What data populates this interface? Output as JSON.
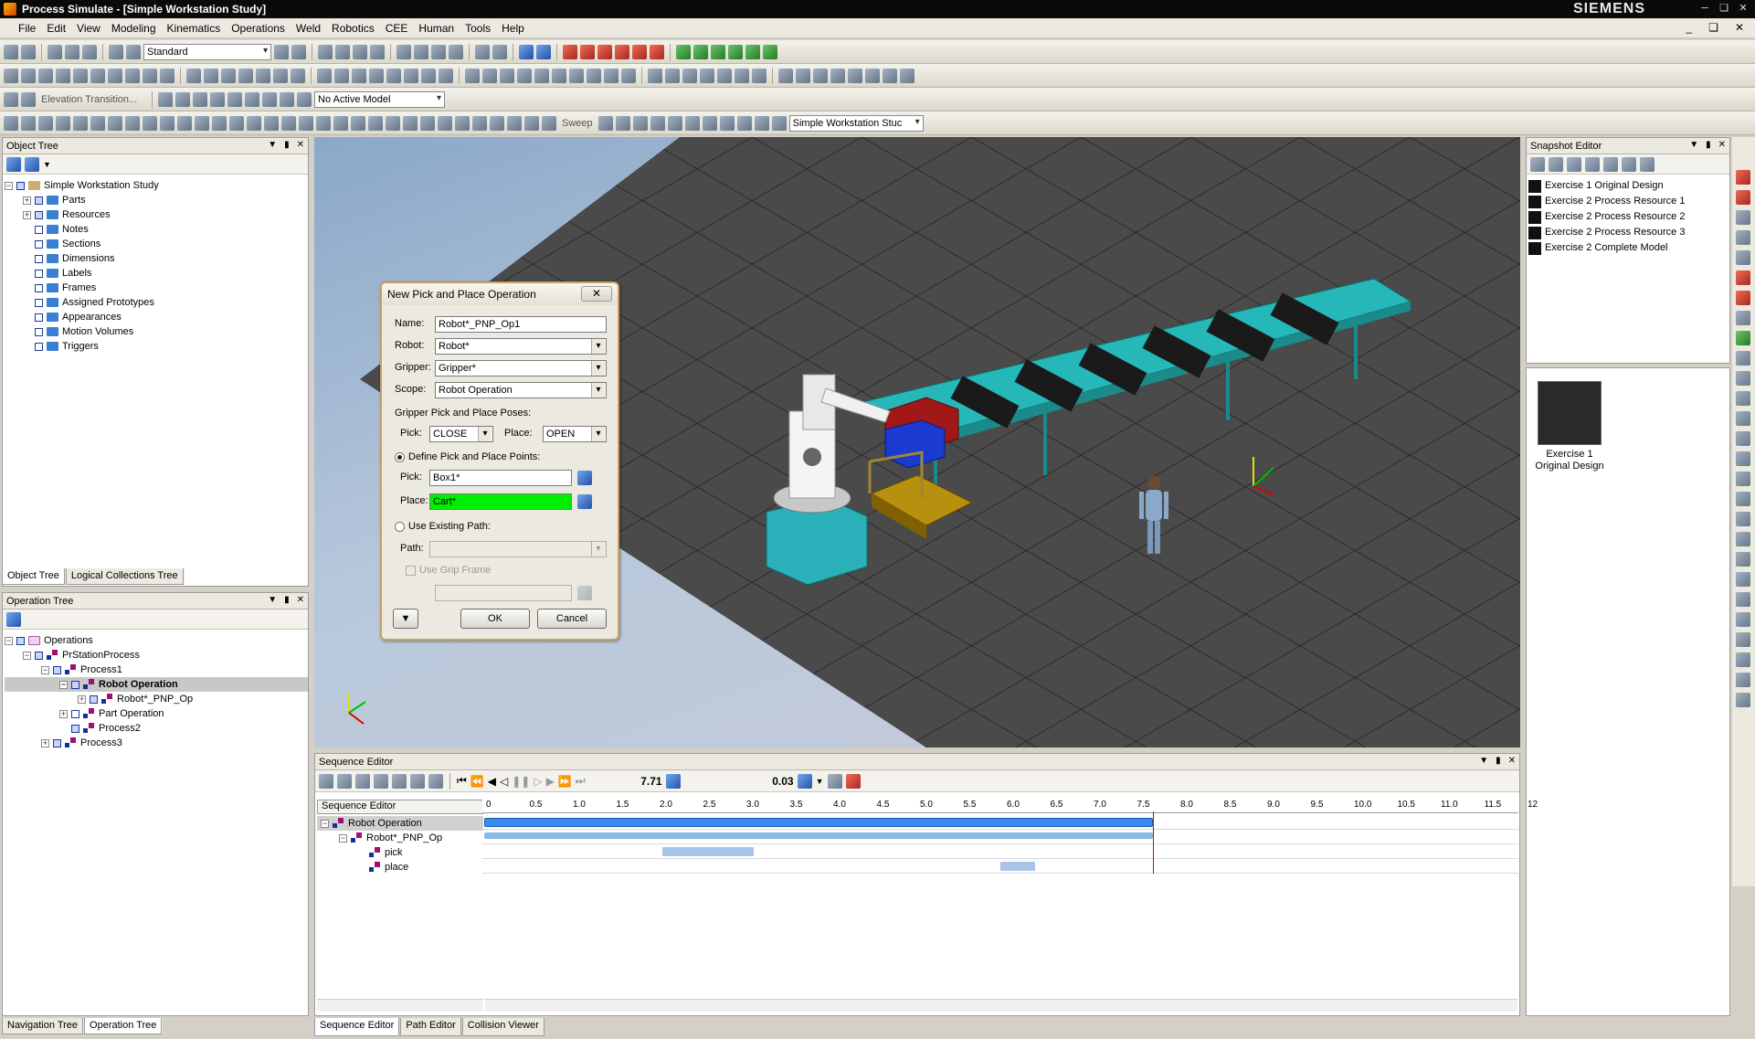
{
  "window": {
    "title": "Process Simulate - [Simple Workstation Study]",
    "brand": "SIEMENS"
  },
  "menu": [
    "File",
    "Edit",
    "View",
    "Modeling",
    "Kinematics",
    "Operations",
    "Weld",
    "Robotics",
    "CEE",
    "Human",
    "Tools",
    "Help"
  ],
  "toolbar": {
    "layout_combo": "Standard",
    "elevation": "Elevation Transition...",
    "model_combo": "No Active Model",
    "sweep": "Sweep",
    "study_combo": "Simple Workstation Stuc"
  },
  "object_tree": {
    "title": "Object Tree",
    "root": "Simple Workstation Study",
    "items": [
      "Parts",
      "Resources",
      "Notes",
      "Sections",
      "Dimensions",
      "Labels",
      "Frames",
      "Assigned Prototypes",
      "Appearances",
      "Motion Volumes",
      "Triggers"
    ],
    "tabs": [
      "Object Tree",
      "Logical Collections Tree"
    ]
  },
  "operation_tree": {
    "title": "Operation Tree",
    "items": [
      {
        "label": "Operations"
      },
      {
        "label": "PrStationProcess"
      },
      {
        "label": "Process1"
      },
      {
        "label": "Robot Operation"
      },
      {
        "label": "Robot*_PNP_Op"
      },
      {
        "label": "Part Operation"
      },
      {
        "label": "Process2"
      },
      {
        "label": "Process3"
      }
    ],
    "tabs": [
      "Navigation Tree",
      "Operation Tree"
    ]
  },
  "dialog": {
    "title": "New Pick and Place Operation",
    "name_label": "Name:",
    "name_value": "Robot*_PNP_Op1",
    "robot_label": "Robot:",
    "robot_value": "Robot*",
    "gripper_label": "Gripper:",
    "gripper_value": "Gripper*",
    "scope_label": "Scope:",
    "scope_value": "Robot Operation",
    "poses_label": "Gripper Pick and Place Poses:",
    "pick_label": "Pick:",
    "pick_pose": "CLOSE",
    "place_label": "Place:",
    "place_pose": "OPEN",
    "define_label": "Define Pick and Place Points:",
    "pick_point": "Box1*",
    "place_point": "Cart*",
    "existing_label": "Use Existing Path:",
    "path_label": "Path:",
    "grip_frame_label": "Use Grip Frame",
    "ok": "OK",
    "cancel": "Cancel"
  },
  "snapshot_editor": {
    "title": "Snapshot Editor",
    "items": [
      "Exercise 1 Original Design",
      "Exercise 2 Process Resource 1",
      "Exercise 2 Process Resource 2",
      "Exercise 2 Process Resource 3",
      "Exercise 2 Complete Model"
    ],
    "thumb_label": "Exercise 1 Original Design"
  },
  "sequence_editor": {
    "title": "Sequence Editor",
    "header": "Sequence Editor",
    "time": "7.71",
    "increment": "0.03",
    "rows": [
      "Robot Operation",
      "Robot*_PNP_Op",
      "pick",
      "place"
    ],
    "ticks": [
      "0",
      "0.5",
      "1.0",
      "1.5",
      "2.0",
      "2.5",
      "3.0",
      "3.5",
      "4.0",
      "4.5",
      "5.0",
      "5.5",
      "6.0",
      "6.5",
      "7.0",
      "7.5",
      "8.0",
      "8.5",
      "9.0",
      "9.5",
      "10.0",
      "10.5",
      "11.0",
      "11.5",
      "12"
    ],
    "tabs": [
      "Sequence Editor",
      "Path Editor",
      "Collision Viewer"
    ],
    "bars": {
      "op_start": 0,
      "op_end": 7.71,
      "pick_start": 2.05,
      "pick_end": 3.1,
      "place_start": 5.95,
      "place_end": 6.35
    }
  }
}
